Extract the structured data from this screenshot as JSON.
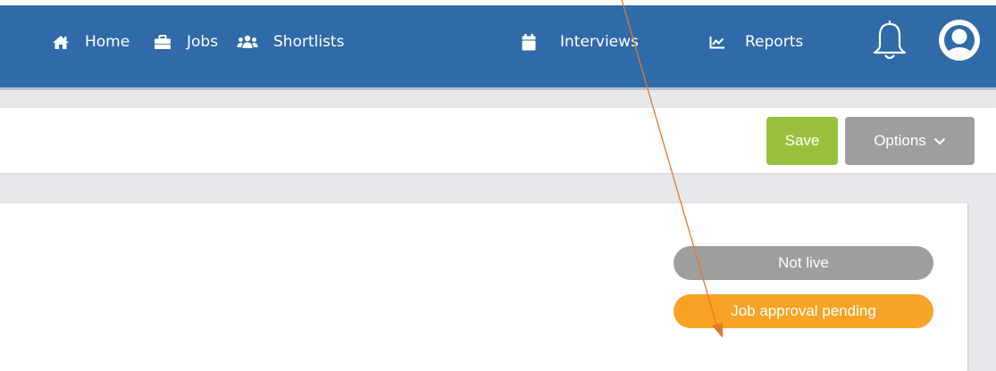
{
  "nav": {
    "items": [
      {
        "label": "Home",
        "icon": "home-icon"
      },
      {
        "label": "Jobs",
        "icon": "briefcase-icon"
      },
      {
        "label": "Shortlists",
        "icon": "users-icon"
      },
      {
        "label": "Interviews",
        "icon": "calendar-icon"
      },
      {
        "label": "Reports",
        "icon": "chart-line-icon"
      }
    ],
    "notification_icon": "bell-icon",
    "profile_icon": "user-avatar-icon"
  },
  "toolbar": {
    "save_label": "Save",
    "options_label": "Options",
    "options_icon": "chevron-down-icon"
  },
  "status": {
    "live_label": "Not live",
    "approval_label": "Job approval pending"
  },
  "colors": {
    "navbar": "#2f6aa9",
    "save": "#98c23d",
    "options": "#9e9e9e",
    "not_live": "#9e9e9e",
    "pending": "#f8a326",
    "annotation": "#e3792b"
  }
}
